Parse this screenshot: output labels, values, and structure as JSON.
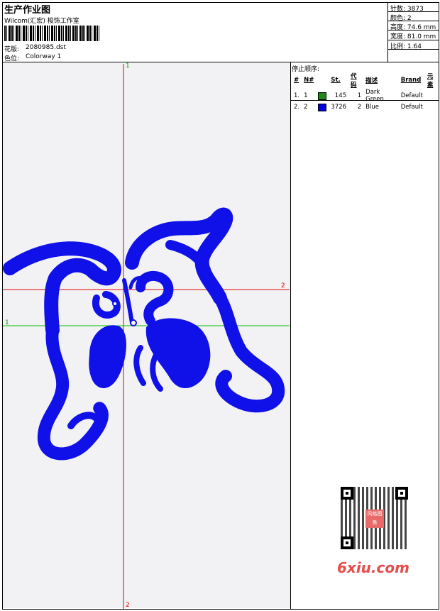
{
  "header": {
    "title": "生产作业图",
    "studio": "Wilcom(汇宏) 梭饰工作室",
    "design_label": "花版:",
    "design_value": "2080985.dst",
    "colorway_label": "色位:",
    "colorway_value": "Colorway 1"
  },
  "stats": {
    "stitches": "针数: 3873",
    "colors": "颜色: 2",
    "height": "高度: 74.6 mm",
    "width": "宽度: 81.0 mm",
    "scale": "比例: 1.64"
  },
  "stop_sequence": {
    "label": "停止顺序:",
    "headers": [
      "#",
      "N#",
      "St.",
      "代码",
      "描述",
      "Brand",
      "元素"
    ],
    "rows": [
      {
        "idx": "1.",
        "n": "1",
        "color": "#1a8a1a",
        "st": "145",
        "code": "1",
        "desc": "Dark Green",
        "brand": "Default"
      },
      {
        "idx": "2.",
        "n": "2",
        "color": "#0000e0",
        "st": "3726",
        "code": "2",
        "desc": "Blue",
        "brand": "Default"
      }
    ]
  },
  "guides": {
    "vertical_top": "1",
    "vertical_bottom": "2",
    "red_horizontal": "2",
    "green_horizontal": "1"
  },
  "colors": {
    "stitch_blue": "#1010e8",
    "guide_red": "#e00000",
    "guide_green": "#00c000"
  },
  "watermark": {
    "text": "6xiu.com",
    "stamp": "风格图秀"
  }
}
